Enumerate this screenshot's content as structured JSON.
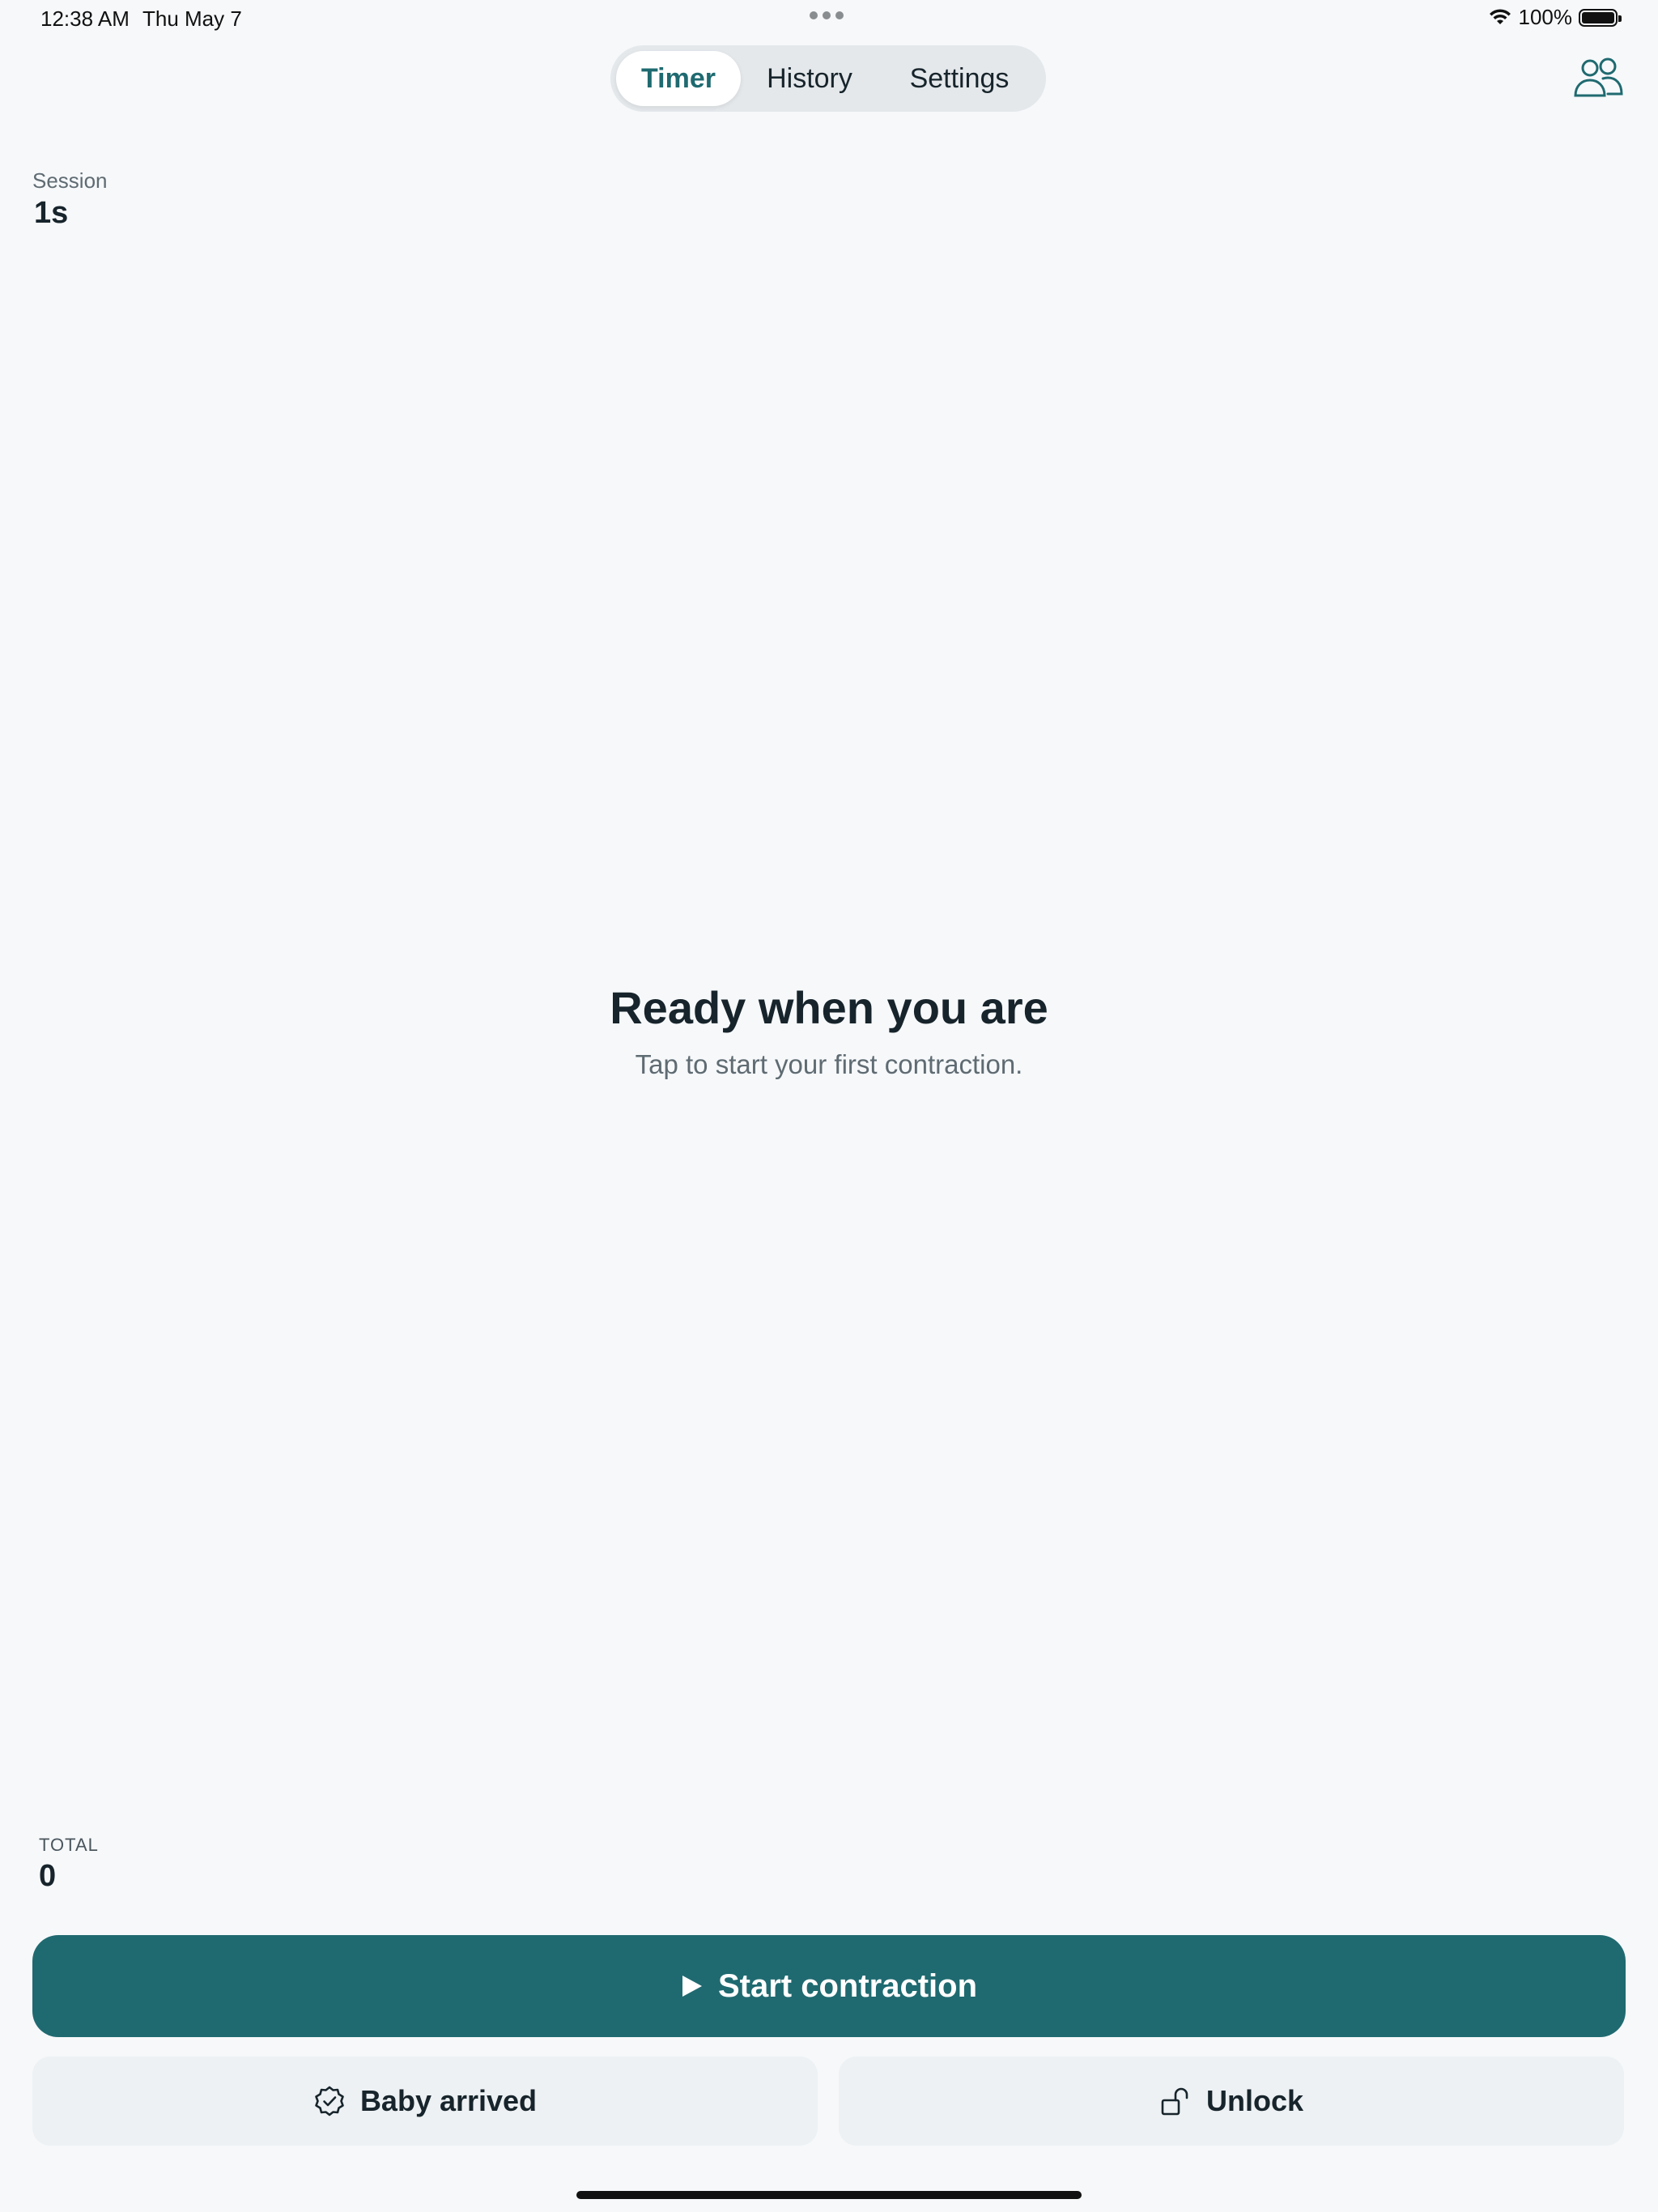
{
  "status_bar": {
    "time": "12:38 AM",
    "date": "Thu May 7",
    "battery_percent": "100%",
    "battery_level": 1.0,
    "icons": [
      "wifi-icon",
      "battery-icon"
    ]
  },
  "nav": {
    "tabs": [
      {
        "label": "Timer",
        "active": true
      },
      {
        "label": "History",
        "active": false
      },
      {
        "label": "Settings",
        "active": false
      }
    ],
    "partner_icon": "people-icon"
  },
  "session": {
    "label": "Session",
    "value": "1s"
  },
  "empty_state": {
    "title": "Ready when you are",
    "subtitle": "Tap to start your first contraction."
  },
  "stats": {
    "total_label": "TOTAL",
    "total_value": "0"
  },
  "actions": {
    "start_label": "Start contraction",
    "start_icon": "play-icon",
    "baby_arrived_label": "Baby arrived",
    "baby_arrived_icon": "check-badge-icon",
    "unlock_label": "Unlock",
    "unlock_icon": "unlock-icon"
  },
  "colors": {
    "accent": "#1f6a70",
    "background": "#f6f8fa",
    "secondary_button": "#edf1f3",
    "text": "#17242b"
  }
}
